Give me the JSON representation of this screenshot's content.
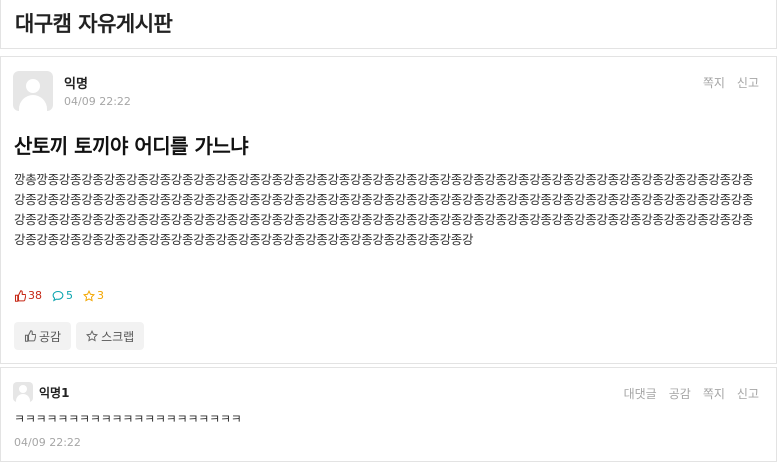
{
  "board": {
    "title": "대구캠 자유게시판"
  },
  "article": {
    "author": "익명",
    "date": "04/09 22:22",
    "actions": {
      "message": "쪽지",
      "report": "신고"
    },
    "title": "산토끼 토끼야 어디를 가느냐",
    "body": "깡총깡종강종강종강종강종강종강종강종강종강종강종강종강종강종강종강종강종강종강종강종강종강종강종강종강종강종강종강종강종강종강종강종강종강종강종강종강종강종강종강종강종강종강종강종강종강종강종강종강종강종강종강종강종강종강종강종강종강종강종강종강종강종강종강종강종강종강종강종강종강종강종강종강종강종강종강종강종강종강종강종강종강종강종강종강종강종강종강종강종강종강종강종강종강종강종강종강종강종강종강종강종강종강종강종강종강종강종강종강종강종강종강종강종강종강종강종강종강종강",
    "stats": {
      "likes": "38",
      "comments": "5",
      "scraps": "3"
    },
    "buttons": {
      "empathy": "공감",
      "scrap": "스크랩"
    },
    "colors": {
      "like": "#c62917",
      "comment": "#0ca5af",
      "scrap": "#f3a600"
    }
  },
  "comment": {
    "author": "익명1",
    "actions": {
      "reply": "대댓글",
      "empathy": "공감",
      "message": "쪽지",
      "report": "신고"
    },
    "text": "ㅋㅋㅋㅋㅋㅋㅋㅋㅋㅋㅋㅋㅋㅋㅋㅋㅋㅋㅋㅋㅋ",
    "date": "04/09 22:22"
  }
}
